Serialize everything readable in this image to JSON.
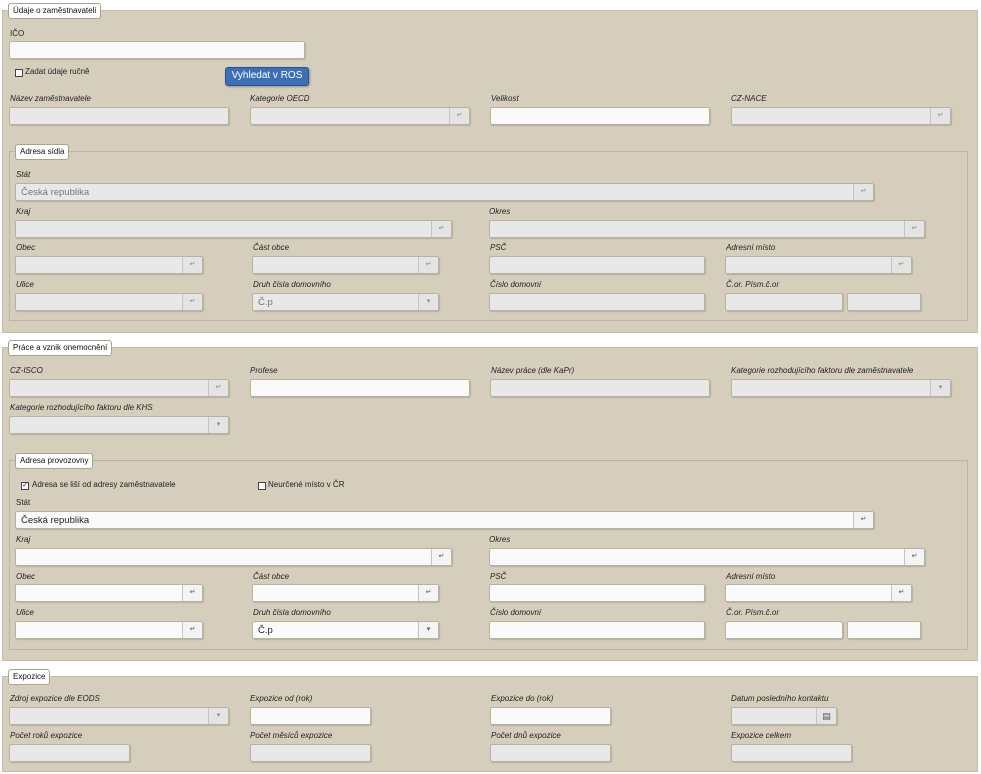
{
  "s1": {
    "legend": "Údaje o zaměstnavateli",
    "ico_label": "IČO",
    "manual_label": "Zadat údaje ručně",
    "ros_button": "Vyhledat v ROS",
    "nazev_label": "Název zaměstnavatele",
    "oecd_label": "Kategorie OECD",
    "velikost_label": "Velikost",
    "nace_label": "CZ-NACE"
  },
  "s1a": {
    "legend": "Adresa sídla",
    "stat_label": "Stát",
    "stat_value": "Česká republika",
    "kraj_label": "Kraj",
    "okres_label": "Okres",
    "obec_label": "Obec",
    "cast_label": "Část obce",
    "psc_label": "PSČ",
    "adresni_label": "Adresní místo",
    "ulice_label": "Ulice",
    "druh_label": "Druh čísla domovního",
    "druh_value": "Č.p",
    "cislo_label": "Číslo domovní",
    "cor_label": "Č.or. Písm.č.or"
  },
  "s2": {
    "legend": "Práce a vznik onemocnění",
    "isco_label": "CZ-ISCO",
    "profese_label": "Profese",
    "nazev_prace_label": "Název práce (dle KaPr)",
    "kat_zam_label": "Kategorie rozhodujícího faktoru dle zaměstnavatele",
    "kat_khs_label": "Kategorie rozhodujícího faktoru dle KHS"
  },
  "s2a": {
    "legend": "Adresa provozovny",
    "lisi_label": "Adresa se liší od adresy zaměstnavatele",
    "lisi_check": "✓",
    "neurcene_label": "Neurčené místo v ČR",
    "stat_label": "Stát",
    "stat_value": "Česká republika",
    "kraj_label": "Kraj",
    "okres_label": "Okres",
    "obec_label": "Obec",
    "cast_label": "Část obce",
    "psc_label": "PSČ",
    "adresni_label": "Adresní místo",
    "ulice_label": "Ulice",
    "druh_label": "Druh čísla domovního",
    "druh_value": "Č.p",
    "cislo_label": "Číslo domovní",
    "cor_label": "Č.or. Písm.č.or"
  },
  "s3": {
    "legend": "Expozice",
    "zdroj_label": "Zdroj expozice dle EODS",
    "od_label": "Expozice od (rok)",
    "do_label": "Expozice do (rok)",
    "datum_label": "Datum posledního kontaktu",
    "roky_label": "Počet roků expozice",
    "mesice_label": "Počet měsíců expozice",
    "dny_label": "Počet dnů expozice",
    "celkem_label": "Expozice celkem"
  },
  "icons": {
    "lookup": "↵",
    "dropdown": "▾",
    "calendar": "▤"
  }
}
